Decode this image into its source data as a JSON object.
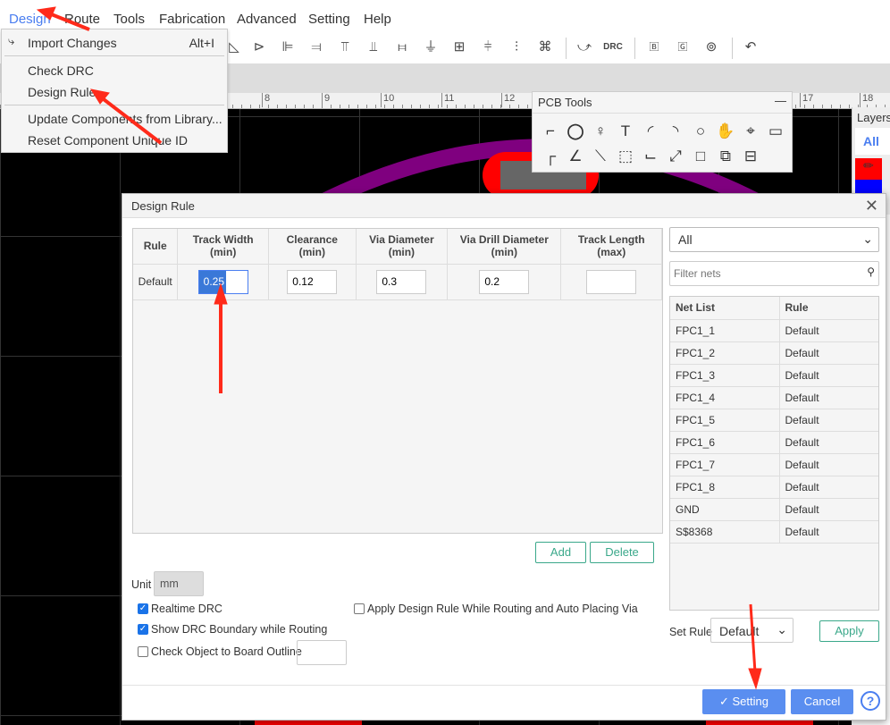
{
  "menubar": {
    "items": [
      "Design",
      "Route",
      "Tools",
      "Fabrication",
      "Advanced",
      "Setting",
      "Help"
    ]
  },
  "design_menu": {
    "items": [
      {
        "label": "Import Changes",
        "shortcut": "Alt+I",
        "icon": "import-icon"
      },
      {
        "label": "Check DRC"
      },
      {
        "label": "Design Rule..."
      },
      {
        "label": "Update Components from Library..."
      },
      {
        "label": "Reset Component Unique ID"
      }
    ]
  },
  "toolbar": {
    "drc_label": "DRC",
    "icons": [
      "mirror-icon",
      "flip-icon",
      "align-left-icon",
      "align-right-icon",
      "align-top-icon",
      "align-bottom-icon",
      "align-hcenter-icon",
      "align-vcenter-icon",
      "grid-icon",
      "distribute-h-icon",
      "distribute-v-icon",
      "group-icon",
      "import-changes-icon",
      "drc-icon",
      "board-b-icon",
      "board-g-icon",
      "board-settings-icon",
      "back-icon"
    ]
  },
  "ruler": {
    "labels": [
      "8",
      "9",
      "10",
      "11",
      "12",
      "17",
      "18"
    ]
  },
  "pcb_tools": {
    "title": "PCB Tools",
    "minimize": "—"
  },
  "layers": {
    "title": "Layers",
    "tab": "All",
    "colors": [
      "#ff0000",
      "#0000ff"
    ]
  },
  "dialog": {
    "title": "Design Rule",
    "columns": [
      "Rule",
      "Track Width\n(min)",
      "Clearance\n(min)",
      "Via Diameter\n(min)",
      "Via Drill Diameter\n(min)",
      "Track Length\n(max)"
    ],
    "rows": [
      {
        "rule": "Default",
        "track_width": "0.25",
        "clearance": "0.12",
        "via_diameter": "0.3",
        "via_drill": "0.2",
        "track_length": ""
      }
    ],
    "add": "Add",
    "delete": "Delete",
    "unit_label": "Unit",
    "unit_value": "mm",
    "checkboxes": [
      {
        "label": "Realtime DRC",
        "checked": true
      },
      {
        "label": "Show DRC Boundary while Routing",
        "checked": true
      },
      {
        "label": "Check Object to Board Outline",
        "checked": false
      },
      {
        "label": "Apply Design Rule While Routing and Auto Placing Via",
        "checked": false
      }
    ],
    "net_filter_select": "All",
    "filter_placeholder": "Filter nets",
    "net_headers": [
      "Net List",
      "Rule"
    ],
    "nets": [
      [
        "FPC1_1",
        "Default"
      ],
      [
        "FPC1_2",
        "Default"
      ],
      [
        "FPC1_3",
        "Default"
      ],
      [
        "FPC1_4",
        "Default"
      ],
      [
        "FPC1_5",
        "Default"
      ],
      [
        "FPC1_6",
        "Default"
      ],
      [
        "FPC1_7",
        "Default"
      ],
      [
        "FPC1_8",
        "Default"
      ],
      [
        "GND",
        "Default"
      ],
      [
        "S$8368",
        "Default"
      ]
    ],
    "set_rule_label": "Set Rule",
    "set_rule_value": "Default",
    "apply": "Apply",
    "setting": "✓  Setting",
    "cancel": "Cancel",
    "help": "?"
  },
  "colors": {
    "accent": "#5a8ef0",
    "green": "#3aa88a",
    "arrow": "#ff2a1a",
    "trace": "#7f007f",
    "pad": "#ff0000"
  }
}
